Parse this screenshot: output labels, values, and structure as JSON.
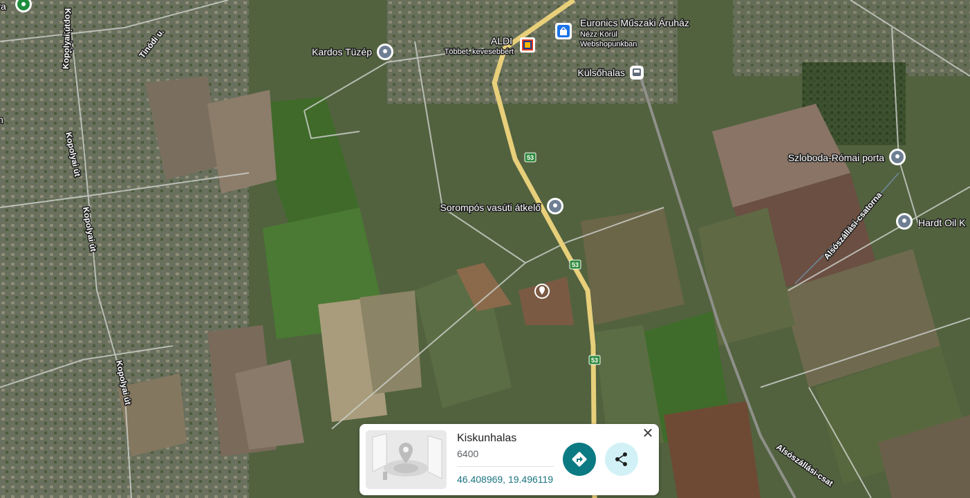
{
  "map": {
    "type": "satellite",
    "places": {
      "kardos": "Kardos Tüzép",
      "aldi": "ALDI",
      "aldi_sub": "Többet, kevesebbért",
      "euronics": "Euronics Műszaki Áruház",
      "euronics_sub1": "Nézz Körül",
      "euronics_sub2": "Webshopunkban",
      "kulsohalas": "Külsőhalas",
      "szloboda": "Szloboda-Római porta",
      "hardt": "Hardt Oil K",
      "sorompos": "Sorompós vasúti átkelő",
      "edge_ya": "ya",
      "edge_n": "n"
    },
    "roads": {
      "tinodi": "Tinódi u.",
      "kopolyai1": "Kopolyai út",
      "kopolyai2": "Kopolyai út",
      "kopolyai3": "Kopolyai út",
      "kopolyai4": "Kopolyai út",
      "kopolyai5": "Kopolyai út",
      "csatorna1": "Alsószállási-csatorna",
      "csatorna2": "Alsószállási-csat",
      "route": "53"
    },
    "colors": {
      "highway": "#e8cf7a",
      "pin": "#6f7f93",
      "route_shield": "#2f8a3c"
    }
  },
  "card": {
    "title": "Kiskunhalas",
    "postcode": "6400",
    "coordinates": "46.408969, 19.496119",
    "close_glyph": "✕",
    "directions_icon": "directions-icon",
    "share_icon": "share-icon",
    "accent": "#0b7a83"
  }
}
